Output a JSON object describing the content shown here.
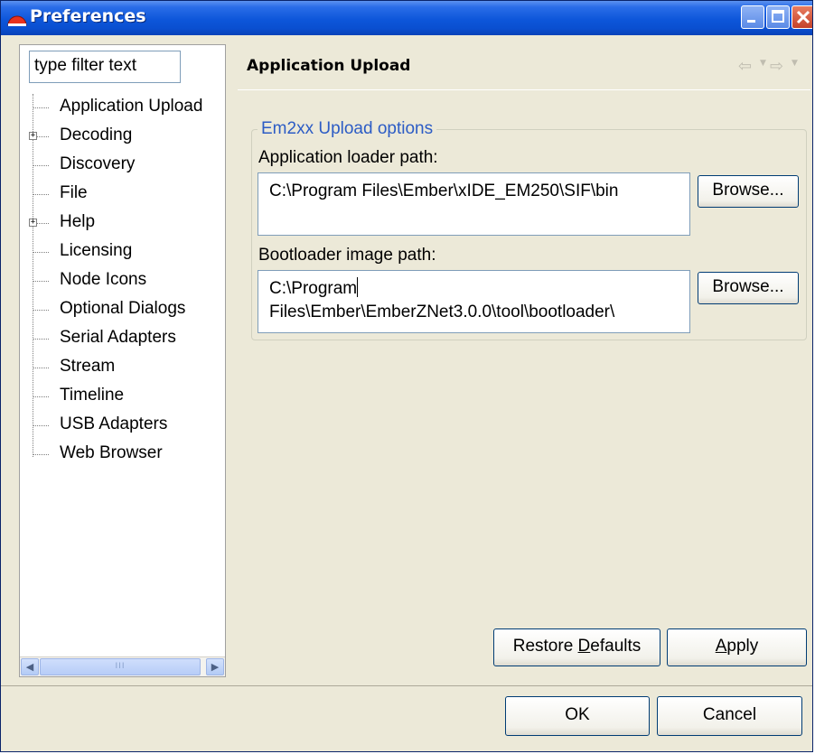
{
  "window": {
    "title": "Preferences"
  },
  "tree": {
    "filter_placeholder": "type filter text",
    "items": [
      {
        "label": "Application Upload",
        "expandable": false,
        "selected": true
      },
      {
        "label": "Decoding",
        "expandable": true
      },
      {
        "label": "Discovery",
        "expandable": false
      },
      {
        "label": "File",
        "expandable": false
      },
      {
        "label": "Help",
        "expandable": true
      },
      {
        "label": "Licensing",
        "expandable": false
      },
      {
        "label": "Node Icons",
        "expandable": false
      },
      {
        "label": "Optional Dialogs",
        "expandable": false
      },
      {
        "label": "Serial Adapters",
        "expandable": false
      },
      {
        "label": "Stream",
        "expandable": false
      },
      {
        "label": "Timeline",
        "expandable": false
      },
      {
        "label": "USB Adapters",
        "expandable": false
      },
      {
        "label": "Web Browser",
        "expandable": false
      }
    ],
    "scroll_thumb_grip": "III"
  },
  "page": {
    "title": "Application Upload",
    "group_label": "Em2xx Upload options",
    "app_loader_label": "Application loader path:",
    "app_loader_value": "C:\\Program Files\\Ember\\xIDE_EM250\\SIF\\bin",
    "bootloader_label": "Bootloader image path:",
    "bootloader_value_line1": "C:\\Program",
    "bootloader_value_line2": "Files\\Ember\\EmberZNet3.0.0\\tool\\bootloader\\",
    "browse_label": "Browse...",
    "restore_defaults_pre": "Restore ",
    "restore_defaults_mnemonic": "D",
    "restore_defaults_post": "efaults",
    "apply_mnemonic": "A",
    "apply_post": "pply"
  },
  "footer": {
    "ok_label": "OK",
    "cancel_label": "Cancel"
  },
  "icons": {
    "app_icon": "eclipse-preferences-icon",
    "nav_back": "back-arrow-icon",
    "nav_forward": "forward-arrow-icon"
  },
  "colors": {
    "titlebar": "#0a4fd0",
    "dialog_bg": "#ece9d8",
    "group_label": "#2c5cc5",
    "close_button": "#c4422a"
  }
}
